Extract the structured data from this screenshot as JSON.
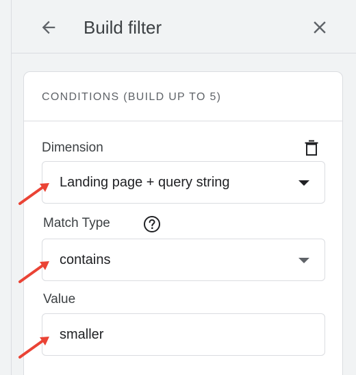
{
  "header": {
    "title": "Build filter",
    "back_icon": "arrow-back-icon",
    "close_icon": "close-icon"
  },
  "card": {
    "title": "CONDITIONS (BUILD UP TO 5)",
    "dimension": {
      "label": "Dimension",
      "value": "Landing page + query string",
      "delete_icon": "trash-icon"
    },
    "match_type": {
      "label": "Match Type",
      "value": "contains",
      "help_icon": "help-icon"
    },
    "value_field": {
      "label": "Value",
      "value": "smaller"
    }
  },
  "colors": {
    "background": "#f1f3f4",
    "card": "#ffffff",
    "border": "#dadce0",
    "annotation_arrow": "#ea4335"
  }
}
